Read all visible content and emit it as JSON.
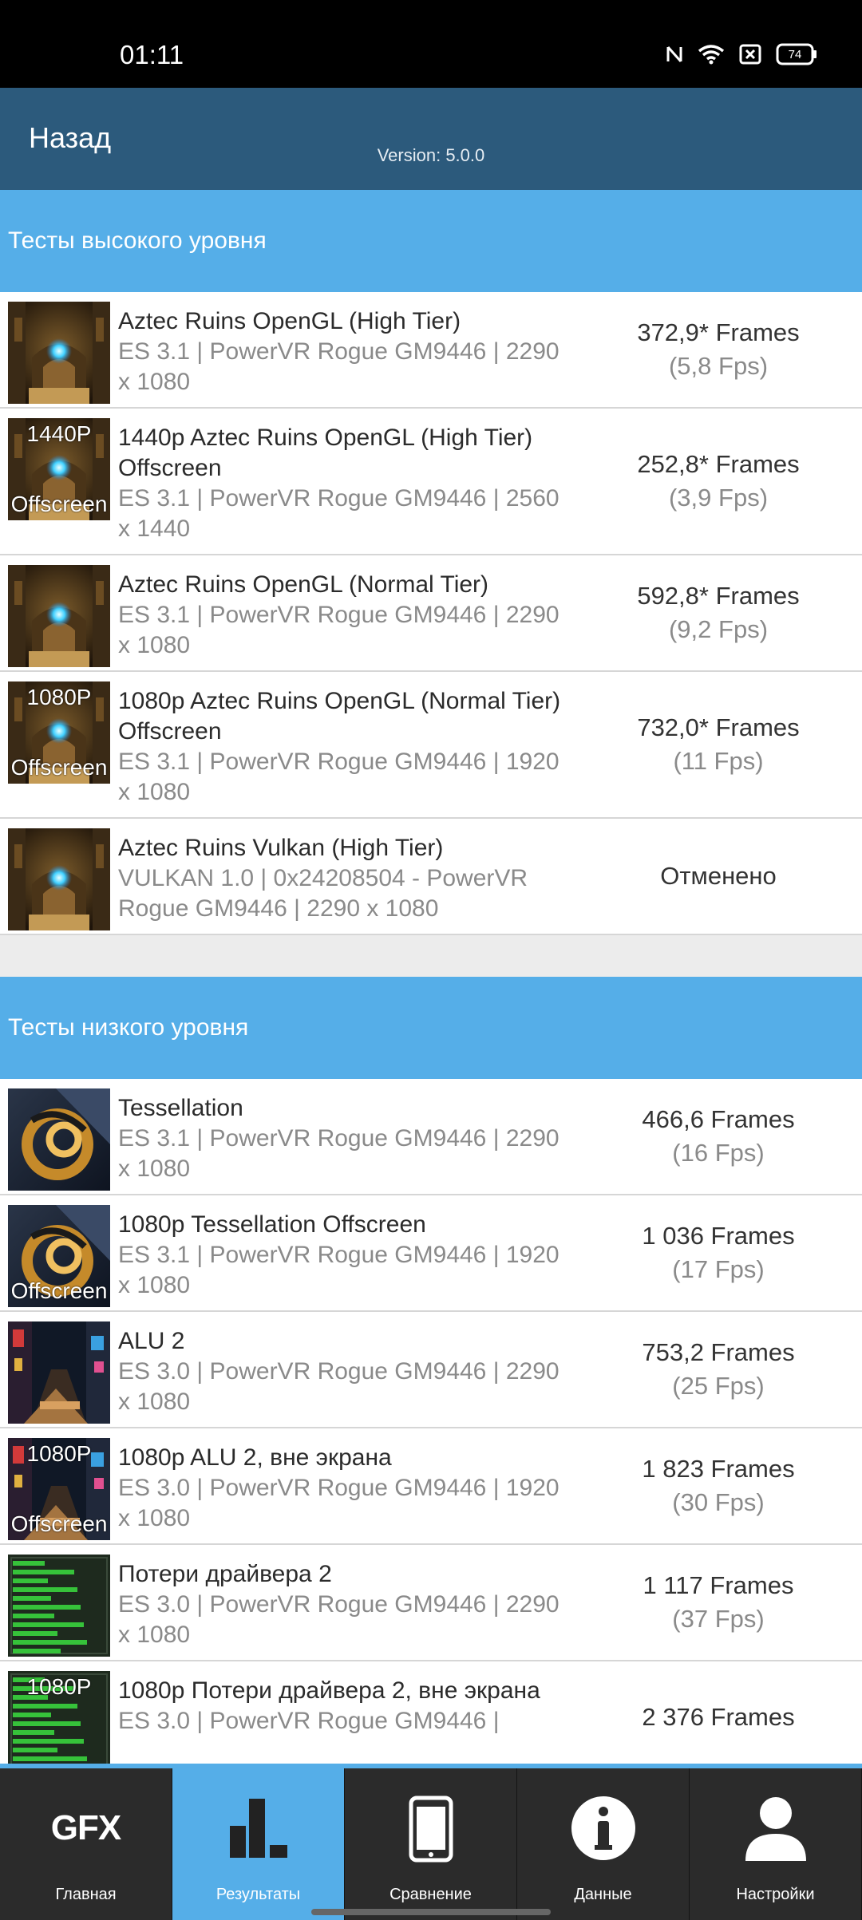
{
  "status_bar": {
    "time": "01:11",
    "battery": "74"
  },
  "header": {
    "back_label": "Назад",
    "version": "Version: 5.0.0"
  },
  "sections": [
    {
      "title": "Тесты высокого уровня",
      "items": [
        {
          "title": "Aztec Ruins OpenGL (High Tier)",
          "sub": "ES 3.1 | PowerVR Rogue GM9446 | 2290 x 1080",
          "frames": "372,9* Frames",
          "fps": "(5,8 Fps)",
          "thumb": "aztec",
          "thumb_label_top": "",
          "thumb_label_bottom": ""
        },
        {
          "title": "1440p Aztec Ruins OpenGL (High Tier) Offscreen",
          "sub": "ES 3.1 | PowerVR Rogue GM9446 | 2560 x 1440",
          "frames": "252,8* Frames",
          "fps": "(3,9 Fps)",
          "thumb": "aztec",
          "thumb_label_top": "1440P",
          "thumb_label_bottom": "Offscreen"
        },
        {
          "title": "Aztec Ruins OpenGL (Normal Tier)",
          "sub": "ES 3.1 | PowerVR Rogue GM9446 | 2290 x 1080",
          "frames": "592,8* Frames",
          "fps": "(9,2 Fps)",
          "thumb": "aztec",
          "thumb_label_top": "",
          "thumb_label_bottom": ""
        },
        {
          "title": "1080p Aztec Ruins OpenGL (Normal Tier) Offscreen",
          "sub": "ES 3.1 | PowerVR Rogue GM9446 | 1920 x 1080",
          "frames": "732,0* Frames",
          "fps": "(11 Fps)",
          "thumb": "aztec",
          "thumb_label_top": "1080P",
          "thumb_label_bottom": "Offscreen"
        },
        {
          "title": "Aztec Ruins Vulkan (High Tier)",
          "sub": "VULKAN 1.0 | 0x24208504 - PowerVR Rogue GM9446 | 2290 x 1080",
          "frames": "Отменено",
          "fps": "",
          "thumb": "aztec",
          "thumb_label_top": "",
          "thumb_label_bottom": ""
        }
      ]
    },
    {
      "title": "Тесты низкого уровня",
      "items": [
        {
          "title": "Tessellation",
          "sub": "ES 3.1 | PowerVR Rogue GM9446 | 2290 x 1080",
          "frames": "466,6 Frames",
          "fps": "(16 Fps)",
          "thumb": "tess",
          "thumb_label_top": "",
          "thumb_label_bottom": ""
        },
        {
          "title": "1080p Tessellation Offscreen",
          "sub": "ES 3.1 | PowerVR Rogue GM9446 | 1920 x 1080",
          "frames": "1 036 Frames",
          "fps": "(17 Fps)",
          "thumb": "tess",
          "thumb_label_top": "",
          "thumb_label_bottom": "Offscreen"
        },
        {
          "title": "ALU 2",
          "sub": "ES 3.0 | PowerVR Rogue GM9446 | 2290 x 1080",
          "frames": "753,2 Frames",
          "fps": "(25 Fps)",
          "thumb": "alu",
          "thumb_label_top": "",
          "thumb_label_bottom": ""
        },
        {
          "title": "1080p ALU 2, вне экрана",
          "sub": "ES 3.0 | PowerVR Rogue GM9446 | 1920 x 1080",
          "frames": "1 823 Frames",
          "fps": "(30 Fps)",
          "thumb": "alu",
          "thumb_label_top": "1080P",
          "thumb_label_bottom": "Offscreen"
        },
        {
          "title": "Потери драйвера 2",
          "sub": "ES 3.0 | PowerVR Rogue GM9446 | 2290 x 1080",
          "frames": "1 117 Frames",
          "fps": "(37 Fps)",
          "thumb": "driver",
          "thumb_label_top": "",
          "thumb_label_bottom": ""
        },
        {
          "title": "1080p Потери драйвера 2, вне экрана",
          "sub": "ES 3.0 | PowerVR Rogue GM9446 |",
          "frames": "2 376 Frames",
          "fps": "",
          "thumb": "driver",
          "thumb_label_top": "1080P",
          "thumb_label_bottom": ""
        }
      ]
    }
  ],
  "bottom_nav": [
    {
      "label": "Главная",
      "icon": "gfx-logo",
      "logo_text": "GFX",
      "active": false
    },
    {
      "label": "Результаты",
      "icon": "bar-chart-icon",
      "active": true
    },
    {
      "label": "Сравнение",
      "icon": "phone-icon",
      "active": false
    },
    {
      "label": "Данные",
      "icon": "info-icon",
      "active": false
    },
    {
      "label": "Настройки",
      "icon": "person-icon",
      "active": false
    }
  ]
}
